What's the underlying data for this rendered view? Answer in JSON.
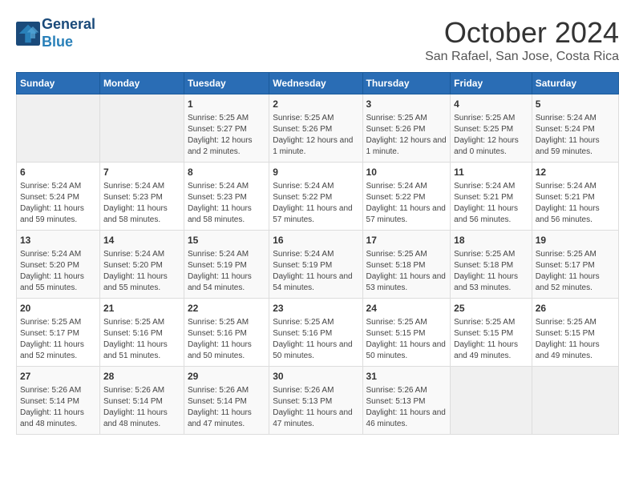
{
  "header": {
    "logo_line1": "General",
    "logo_line2": "Blue",
    "month": "October 2024",
    "location": "San Rafael, San Jose, Costa Rica"
  },
  "weekdays": [
    "Sunday",
    "Monday",
    "Tuesday",
    "Wednesday",
    "Thursday",
    "Friday",
    "Saturday"
  ],
  "weeks": [
    [
      {
        "day": "",
        "sunrise": "",
        "sunset": "",
        "daylight": ""
      },
      {
        "day": "",
        "sunrise": "",
        "sunset": "",
        "daylight": ""
      },
      {
        "day": "1",
        "sunrise": "Sunrise: 5:25 AM",
        "sunset": "Sunset: 5:27 PM",
        "daylight": "Daylight: 12 hours and 2 minutes."
      },
      {
        "day": "2",
        "sunrise": "Sunrise: 5:25 AM",
        "sunset": "Sunset: 5:26 PM",
        "daylight": "Daylight: 12 hours and 1 minute."
      },
      {
        "day": "3",
        "sunrise": "Sunrise: 5:25 AM",
        "sunset": "Sunset: 5:26 PM",
        "daylight": "Daylight: 12 hours and 1 minute."
      },
      {
        "day": "4",
        "sunrise": "Sunrise: 5:25 AM",
        "sunset": "Sunset: 5:25 PM",
        "daylight": "Daylight: 12 hours and 0 minutes."
      },
      {
        "day": "5",
        "sunrise": "Sunrise: 5:24 AM",
        "sunset": "Sunset: 5:24 PM",
        "daylight": "Daylight: 11 hours and 59 minutes."
      }
    ],
    [
      {
        "day": "6",
        "sunrise": "Sunrise: 5:24 AM",
        "sunset": "Sunset: 5:24 PM",
        "daylight": "Daylight: 11 hours and 59 minutes."
      },
      {
        "day": "7",
        "sunrise": "Sunrise: 5:24 AM",
        "sunset": "Sunset: 5:23 PM",
        "daylight": "Daylight: 11 hours and 58 minutes."
      },
      {
        "day": "8",
        "sunrise": "Sunrise: 5:24 AM",
        "sunset": "Sunset: 5:23 PM",
        "daylight": "Daylight: 11 hours and 58 minutes."
      },
      {
        "day": "9",
        "sunrise": "Sunrise: 5:24 AM",
        "sunset": "Sunset: 5:22 PM",
        "daylight": "Daylight: 11 hours and 57 minutes."
      },
      {
        "day": "10",
        "sunrise": "Sunrise: 5:24 AM",
        "sunset": "Sunset: 5:22 PM",
        "daylight": "Daylight: 11 hours and 57 minutes."
      },
      {
        "day": "11",
        "sunrise": "Sunrise: 5:24 AM",
        "sunset": "Sunset: 5:21 PM",
        "daylight": "Daylight: 11 hours and 56 minutes."
      },
      {
        "day": "12",
        "sunrise": "Sunrise: 5:24 AM",
        "sunset": "Sunset: 5:21 PM",
        "daylight": "Daylight: 11 hours and 56 minutes."
      }
    ],
    [
      {
        "day": "13",
        "sunrise": "Sunrise: 5:24 AM",
        "sunset": "Sunset: 5:20 PM",
        "daylight": "Daylight: 11 hours and 55 minutes."
      },
      {
        "day": "14",
        "sunrise": "Sunrise: 5:24 AM",
        "sunset": "Sunset: 5:20 PM",
        "daylight": "Daylight: 11 hours and 55 minutes."
      },
      {
        "day": "15",
        "sunrise": "Sunrise: 5:24 AM",
        "sunset": "Sunset: 5:19 PM",
        "daylight": "Daylight: 11 hours and 54 minutes."
      },
      {
        "day": "16",
        "sunrise": "Sunrise: 5:24 AM",
        "sunset": "Sunset: 5:19 PM",
        "daylight": "Daylight: 11 hours and 54 minutes."
      },
      {
        "day": "17",
        "sunrise": "Sunrise: 5:25 AM",
        "sunset": "Sunset: 5:18 PM",
        "daylight": "Daylight: 11 hours and 53 minutes."
      },
      {
        "day": "18",
        "sunrise": "Sunrise: 5:25 AM",
        "sunset": "Sunset: 5:18 PM",
        "daylight": "Daylight: 11 hours and 53 minutes."
      },
      {
        "day": "19",
        "sunrise": "Sunrise: 5:25 AM",
        "sunset": "Sunset: 5:17 PM",
        "daylight": "Daylight: 11 hours and 52 minutes."
      }
    ],
    [
      {
        "day": "20",
        "sunrise": "Sunrise: 5:25 AM",
        "sunset": "Sunset: 5:17 PM",
        "daylight": "Daylight: 11 hours and 52 minutes."
      },
      {
        "day": "21",
        "sunrise": "Sunrise: 5:25 AM",
        "sunset": "Sunset: 5:16 PM",
        "daylight": "Daylight: 11 hours and 51 minutes."
      },
      {
        "day": "22",
        "sunrise": "Sunrise: 5:25 AM",
        "sunset": "Sunset: 5:16 PM",
        "daylight": "Daylight: 11 hours and 50 minutes."
      },
      {
        "day": "23",
        "sunrise": "Sunrise: 5:25 AM",
        "sunset": "Sunset: 5:16 PM",
        "daylight": "Daylight: 11 hours and 50 minutes."
      },
      {
        "day": "24",
        "sunrise": "Sunrise: 5:25 AM",
        "sunset": "Sunset: 5:15 PM",
        "daylight": "Daylight: 11 hours and 50 minutes."
      },
      {
        "day": "25",
        "sunrise": "Sunrise: 5:25 AM",
        "sunset": "Sunset: 5:15 PM",
        "daylight": "Daylight: 11 hours and 49 minutes."
      },
      {
        "day": "26",
        "sunrise": "Sunrise: 5:25 AM",
        "sunset": "Sunset: 5:15 PM",
        "daylight": "Daylight: 11 hours and 49 minutes."
      }
    ],
    [
      {
        "day": "27",
        "sunrise": "Sunrise: 5:26 AM",
        "sunset": "Sunset: 5:14 PM",
        "daylight": "Daylight: 11 hours and 48 minutes."
      },
      {
        "day": "28",
        "sunrise": "Sunrise: 5:26 AM",
        "sunset": "Sunset: 5:14 PM",
        "daylight": "Daylight: 11 hours and 48 minutes."
      },
      {
        "day": "29",
        "sunrise": "Sunrise: 5:26 AM",
        "sunset": "Sunset: 5:14 PM",
        "daylight": "Daylight: 11 hours and 47 minutes."
      },
      {
        "day": "30",
        "sunrise": "Sunrise: 5:26 AM",
        "sunset": "Sunset: 5:13 PM",
        "daylight": "Daylight: 11 hours and 47 minutes."
      },
      {
        "day": "31",
        "sunrise": "Sunrise: 5:26 AM",
        "sunset": "Sunset: 5:13 PM",
        "daylight": "Daylight: 11 hours and 46 minutes."
      },
      {
        "day": "",
        "sunrise": "",
        "sunset": "",
        "daylight": ""
      },
      {
        "day": "",
        "sunrise": "",
        "sunset": "",
        "daylight": ""
      }
    ]
  ]
}
